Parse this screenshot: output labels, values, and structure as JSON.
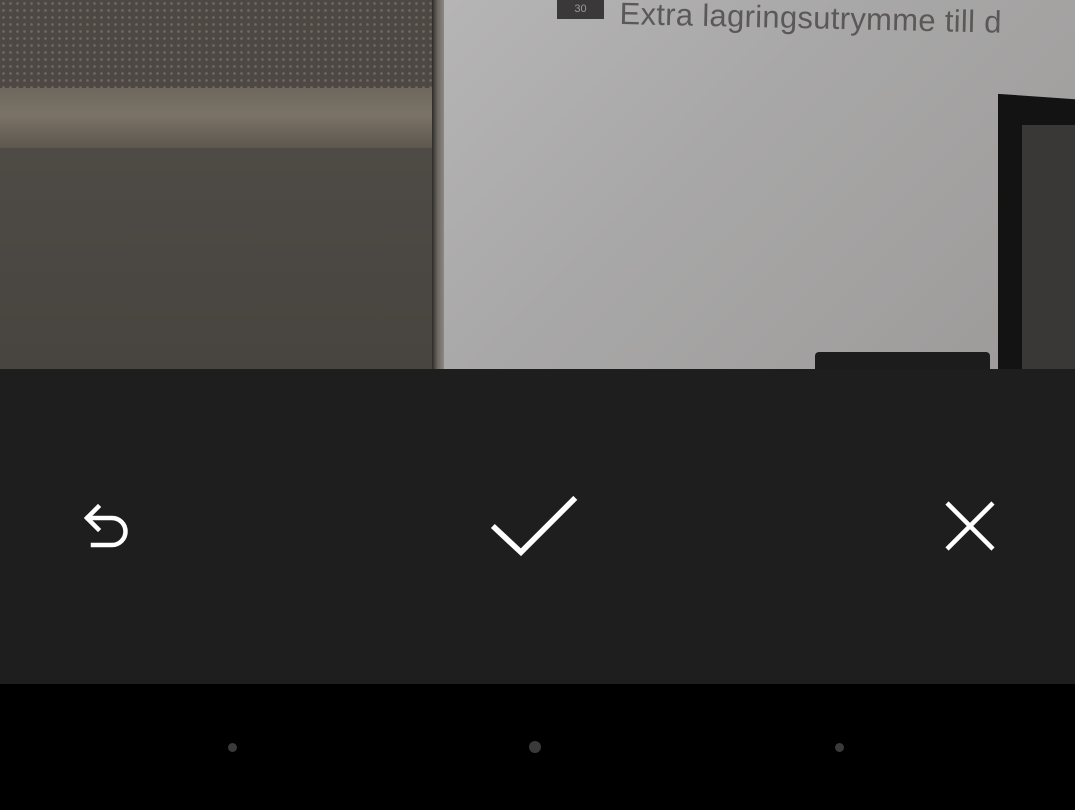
{
  "preview": {
    "badge_text": "30",
    "paper_text": "Extra lagringsutrymme till d"
  },
  "controls": {
    "retake": {
      "icon": "retake-arrow-icon"
    },
    "done": {
      "icon": "checkmark-icon"
    },
    "cancel": {
      "icon": "close-icon"
    }
  },
  "navbar": {
    "items": [
      {
        "icon": "back-dot-icon"
      },
      {
        "icon": "home-dot-icon"
      },
      {
        "icon": "recent-apps-dot-icon"
      }
    ]
  },
  "colors": {
    "control_bar": "#1e1e1e",
    "nav_bar": "#000000",
    "icon": "#ffffff",
    "nav_dot": "#3a3a3a"
  }
}
